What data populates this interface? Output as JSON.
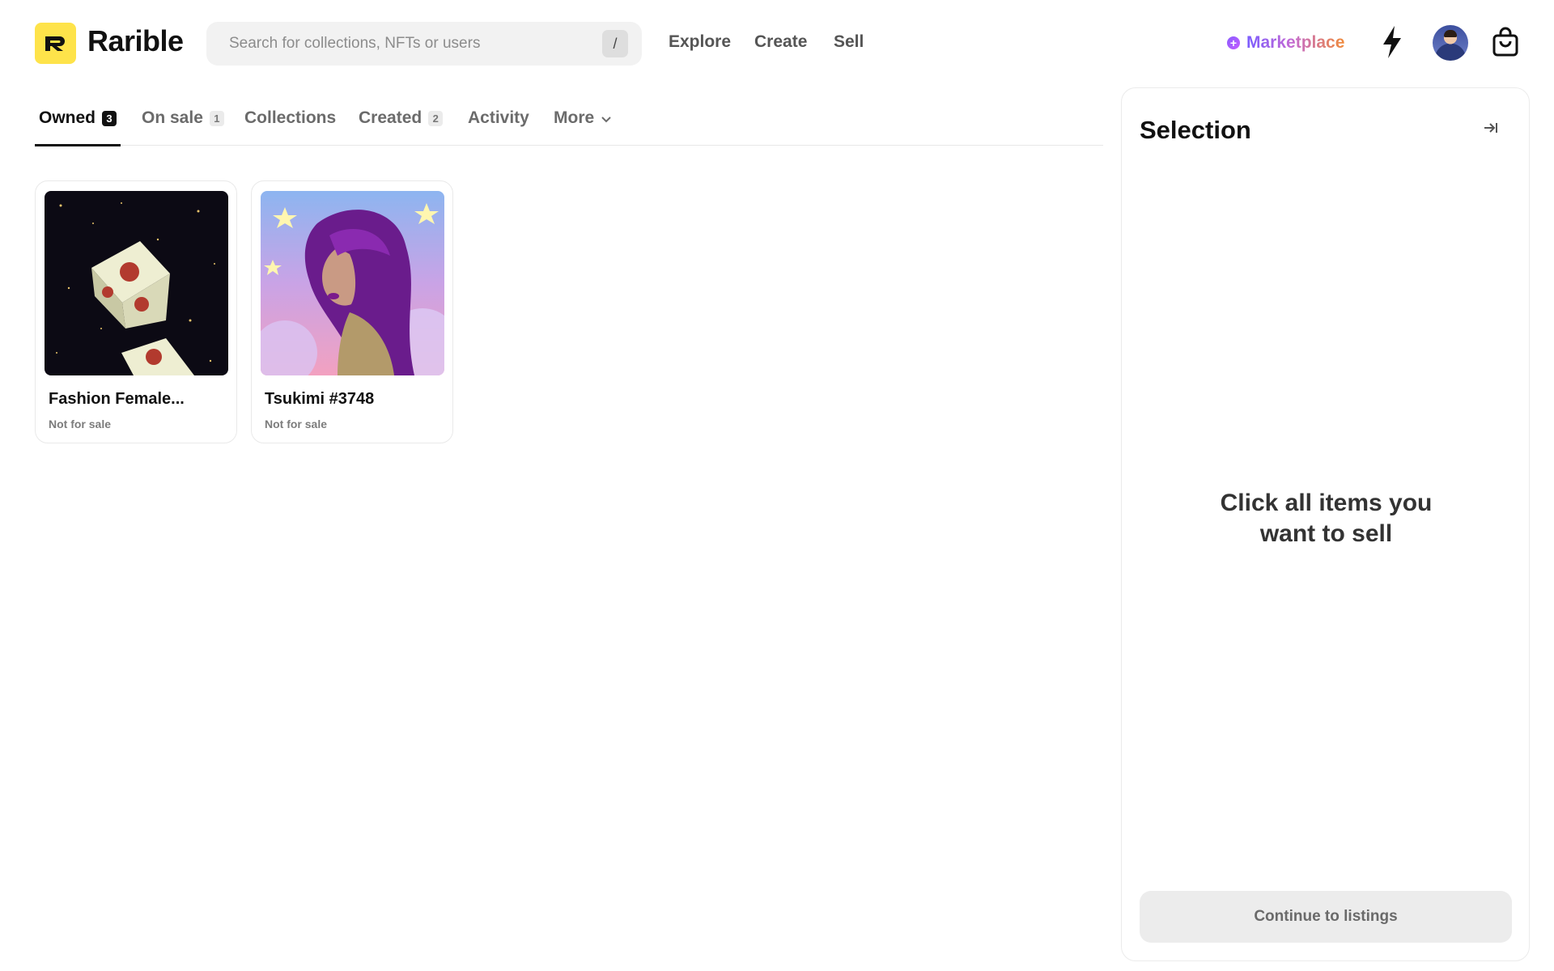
{
  "app": {
    "name": "Rarible"
  },
  "header": {
    "search_placeholder": "Search for collections, NFTs or users",
    "search_shortcut": "/",
    "nav": [
      "Explore",
      "Create",
      "Sell"
    ],
    "marketplace_label": "Marketplace",
    "marketplace_icon": "+"
  },
  "tabs": [
    {
      "label": "Owned",
      "count": "3",
      "active": true
    },
    {
      "label": "On sale",
      "count": "1"
    },
    {
      "label": "Collections"
    },
    {
      "label": "Created",
      "count": "2"
    },
    {
      "label": "Activity"
    },
    {
      "label": "More"
    }
  ],
  "items": [
    {
      "title": "Fashion Female...",
      "status": "Not for sale"
    },
    {
      "title": "Tsukimi #3748",
      "status": "Not for sale"
    }
  ],
  "selection": {
    "title": "Selection",
    "hint": "Click all items you want to sell",
    "continue_label": "Continue to listings"
  },
  "colors": {
    "brand_yellow": "#fee34a",
    "marketplace_gradient": [
      "#7a5cff",
      "#c26ad6",
      "#f08a3a"
    ]
  }
}
